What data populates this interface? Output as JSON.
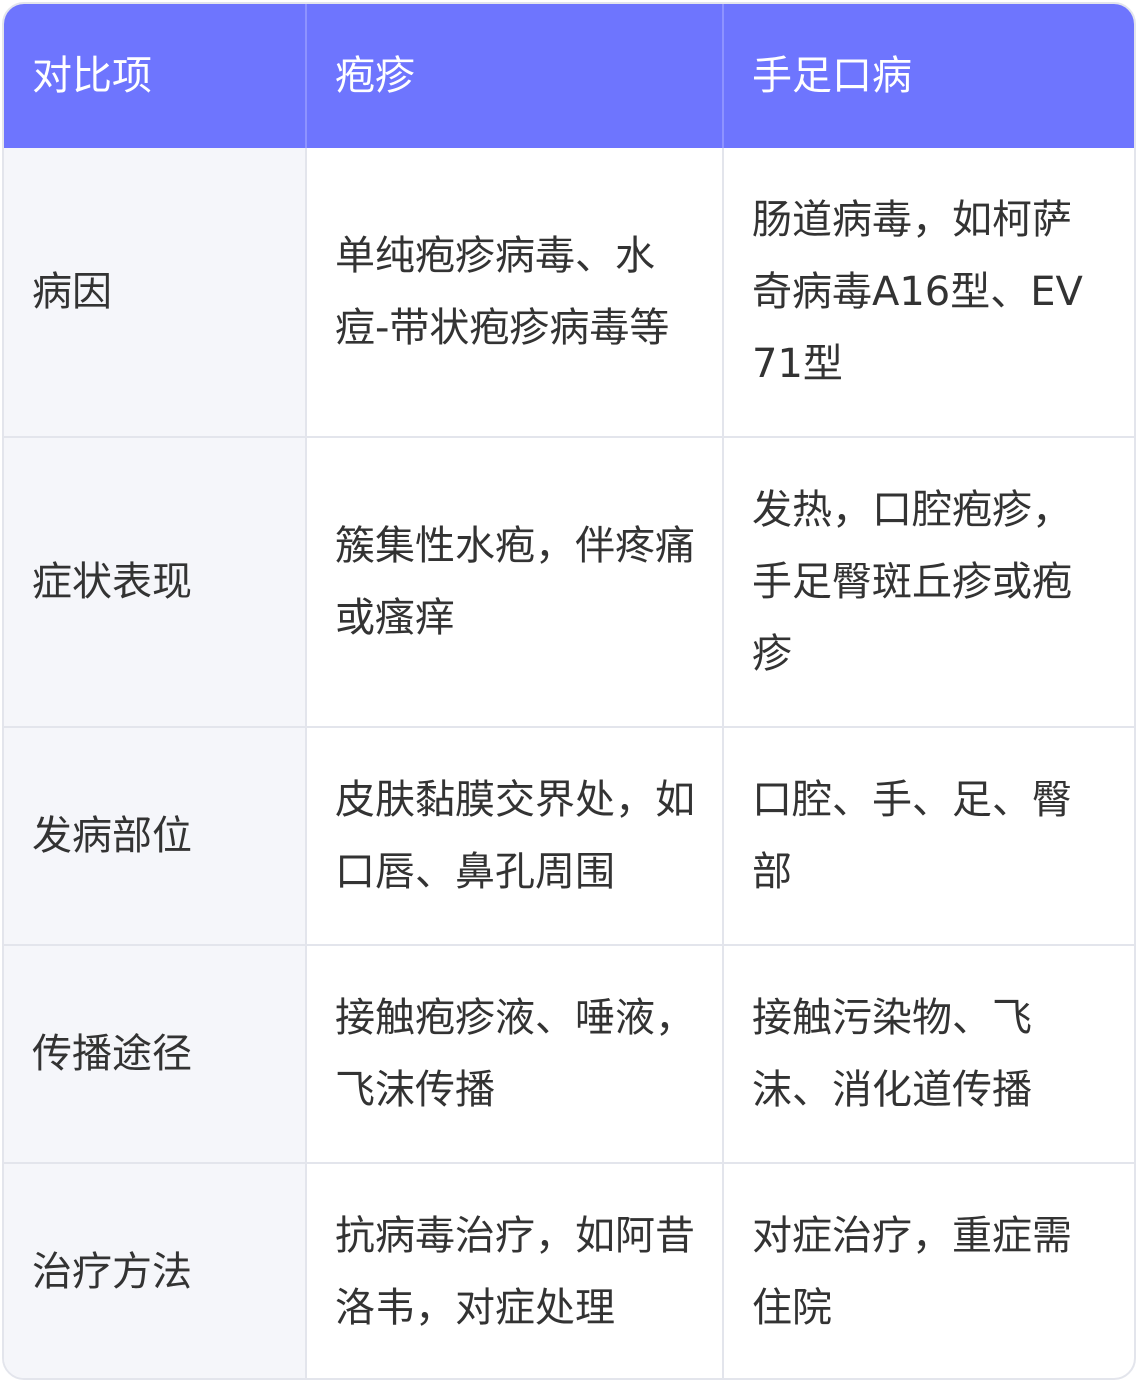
{
  "table": {
    "headers": [
      "对比项",
      "疱疹",
      "手足口病"
    ],
    "rows": [
      {
        "item": "病因",
        "herpes": "单纯疱疹病毒、水痘-带状疱疹病毒等",
        "hfmd": "肠道病毒，如柯萨奇病毒A16型、EV71型"
      },
      {
        "item": "症状表现",
        "herpes": "簇集性水疱，伴疼痛或瘙痒",
        "hfmd": "发热，口腔疱疹，手足臀斑丘疹或疱疹"
      },
      {
        "item": "发病部位",
        "herpes": "皮肤黏膜交界处，如口唇、鼻孔周围",
        "hfmd": "口腔、手、足、臀部"
      },
      {
        "item": "传播途径",
        "herpes": "接触疱疹液、唾液，飞沫传播",
        "hfmd": "接触污染物、飞沫、消化道传播"
      },
      {
        "item": "治疗方法",
        "herpes": "抗病毒治疗，如阿昔洛韦，对症处理",
        "hfmd": "对症治疗，重症需住院"
      }
    ]
  },
  "colors": {
    "header_bg": "#6e75fe",
    "header_text": "#ffffff",
    "row_head_bg": "#f5f6fa",
    "border": "#e3e5ec",
    "text": "#333333"
  }
}
